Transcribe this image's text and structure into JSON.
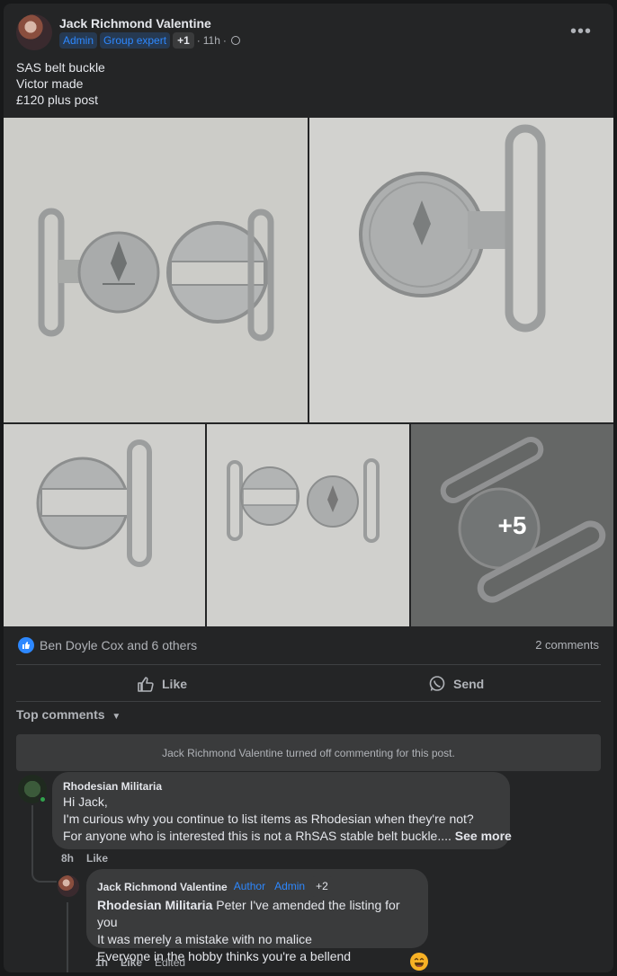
{
  "post": {
    "author": "Jack Richmond Valentine",
    "badges": [
      "Admin",
      "Group expert"
    ],
    "extra_badge": "+1",
    "time": "11h",
    "more": "•••",
    "text_lines": [
      "SAS belt buckle",
      "Victor made",
      "£120 plus post"
    ]
  },
  "gallery": {
    "more_count": "+5"
  },
  "reactions": {
    "text": "Ben Doyle Cox and 6 others",
    "comments": "2 comments"
  },
  "actions": {
    "like": "Like",
    "send": "Send"
  },
  "sort_label": "Top comments",
  "notice": "Jack Richmond Valentine turned off commenting for this post.",
  "comments": [
    {
      "name": "Rhodesian Militaria",
      "lines": [
        "Hi Jack,",
        "I'm curious why you continue to list items as Rhodesian when they're not?",
        "For anyone who is interested this is not a RhSAS stable belt buckle...."
      ],
      "see_more": "See more",
      "time": "8h",
      "like": "Like"
    }
  ],
  "reply": {
    "name": "Jack Richmond Valentine",
    "badges": [
      "Author",
      "Admin"
    ],
    "extra_badge": "+2",
    "mention": "Rhodesian Militaria",
    "first_line": " Peter I've amended the listing for you",
    "lines": [
      "It was merely a mistake with no malice",
      "Everyone in the hobby thinks you're a bellend"
    ],
    "time": "1h",
    "like": "Like",
    "edited": "Edited"
  },
  "colors": {
    "accent": "#2d88ff",
    "card": "#242526",
    "bubble": "#3a3b3c"
  }
}
